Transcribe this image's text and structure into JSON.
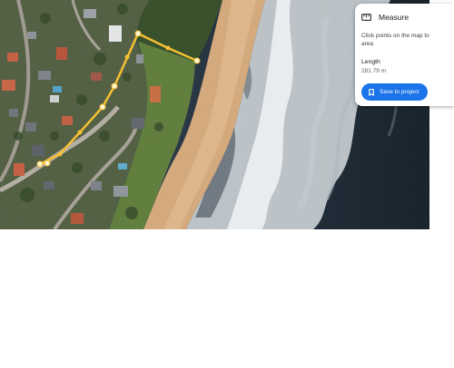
{
  "panel": {
    "icon": "ruler-icon",
    "title": "Measure",
    "instruction_line1": "Click points on the map to",
    "instruction_line2": "area",
    "length_label": "Length",
    "length_value": "281.79 m",
    "save_icon": "bookmark-icon",
    "save_label": "Save to project"
  },
  "colors": {
    "accent": "#1a73e8",
    "measure_line": "#f5c032",
    "ocean": "#101e2b",
    "sand": "#d6a878",
    "vegetation": "#3b5a2a"
  }
}
